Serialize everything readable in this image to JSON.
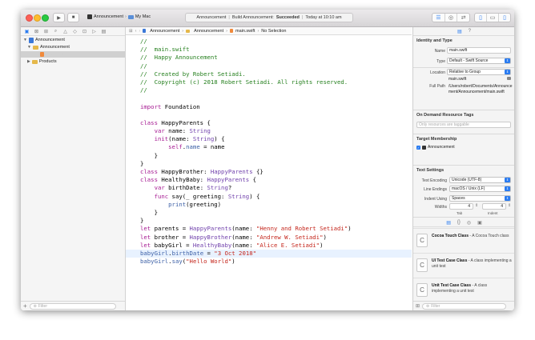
{
  "toolbar": {
    "run_icon": "play-icon",
    "stop_icon": "stop-icon",
    "scheme": "Announcement",
    "destination": "My Mac",
    "status_project": "Announcement",
    "status_build": "Build Announcement:",
    "status_result": "Succeeded",
    "status_time": "Today at 10:10 am"
  },
  "navigator": {
    "tabs": [
      "folder-icon",
      "source-control-icon",
      "symbol-icon",
      "find-icon",
      "issue-icon",
      "test-icon",
      "debug-icon",
      "breakpoint-icon",
      "report-icon"
    ],
    "tree": [
      {
        "label": "Announcement",
        "type": "project"
      },
      {
        "label": "Announcement",
        "type": "folder"
      },
      {
        "label": "main.swift",
        "type": "file"
      },
      {
        "label": "Products",
        "type": "folder"
      }
    ],
    "filter_placeholder": "Filter"
  },
  "jump_bar": {
    "items": [
      "Announcement",
      "Announcement",
      "main.swift",
      "No Selection"
    ]
  },
  "code_lines": [
    [
      [
        "//",
        "cmt"
      ]
    ],
    [
      [
        "//  main.swift",
        "cmt"
      ]
    ],
    [
      [
        "//  Happy Announcement",
        "cmt"
      ]
    ],
    [
      [
        "//",
        "cmt"
      ]
    ],
    [
      [
        "//  Created by Robert Setiadi.",
        "cmt"
      ]
    ],
    [
      [
        "//  Copyright (c) 2018 Robert Setiadi. All rights reserved.",
        "cmt"
      ]
    ],
    [
      [
        "//",
        "cmt"
      ]
    ],
    [],
    [
      [
        "import",
        "kw"
      ],
      [
        " Foundation",
        "plain"
      ]
    ],
    [],
    [
      [
        "class",
        "kw"
      ],
      [
        " HappyParents {",
        "plain"
      ]
    ],
    [
      [
        "    ",
        "plain"
      ],
      [
        "var",
        "kw"
      ],
      [
        " name: ",
        "plain"
      ],
      [
        "String",
        "typ"
      ]
    ],
    [
      [
        "    ",
        "plain"
      ],
      [
        "init",
        "kw"
      ],
      [
        "(name: ",
        "plain"
      ],
      [
        "String",
        "typ"
      ],
      [
        ") {",
        "plain"
      ]
    ],
    [
      [
        "        ",
        "plain"
      ],
      [
        "self",
        "kw"
      ],
      [
        ".",
        "plain"
      ],
      [
        "name",
        "fn"
      ],
      [
        " = name",
        "plain"
      ]
    ],
    [
      [
        "    }",
        "plain"
      ]
    ],
    [
      [
        "}",
        "plain"
      ]
    ],
    [
      [
        "class",
        "kw"
      ],
      [
        " HappyBrother: ",
        "plain"
      ],
      [
        "HappyParents",
        "typ"
      ],
      [
        " {}",
        "plain"
      ]
    ],
    [
      [
        "class",
        "kw"
      ],
      [
        " HealthyBaby: ",
        "plain"
      ],
      [
        "HappyParents",
        "typ"
      ],
      [
        " {",
        "plain"
      ]
    ],
    [
      [
        "    ",
        "plain"
      ],
      [
        "var",
        "kw"
      ],
      [
        " birthDate: ",
        "plain"
      ],
      [
        "String",
        "typ"
      ],
      [
        "?",
        "plain"
      ]
    ],
    [
      [
        "    ",
        "plain"
      ],
      [
        "func",
        "kw"
      ],
      [
        " say(_ greeting: ",
        "plain"
      ],
      [
        "String",
        "typ"
      ],
      [
        ") {",
        "plain"
      ]
    ],
    [
      [
        "        ",
        "plain"
      ],
      [
        "print",
        "fn"
      ],
      [
        "(greeting)",
        "plain"
      ]
    ],
    [
      [
        "    }",
        "plain"
      ]
    ],
    [
      [
        "}",
        "plain"
      ]
    ],
    [
      [
        "let",
        "kw"
      ],
      [
        " parents = ",
        "plain"
      ],
      [
        "HappyParents",
        "typ"
      ],
      [
        "(name: ",
        "plain"
      ],
      [
        "\"Henny and Robert Setiadi\"",
        "str"
      ],
      [
        ")",
        "plain"
      ]
    ],
    [
      [
        "let",
        "kw"
      ],
      [
        " brother = ",
        "plain"
      ],
      [
        "HappyBrother",
        "typ"
      ],
      [
        "(name: ",
        "plain"
      ],
      [
        "\"Andrew W. Setiadi\"",
        "str"
      ],
      [
        ")",
        "plain"
      ]
    ],
    [
      [
        "let",
        "kw"
      ],
      [
        " babyGirl = ",
        "plain"
      ],
      [
        "HealthyBaby",
        "typ"
      ],
      [
        "(name: ",
        "plain"
      ],
      [
        "\"Alice E. Setiadi\"",
        "str"
      ],
      [
        ")",
        "plain"
      ]
    ],
    [
      [
        "babyGirl",
        "fn"
      ],
      [
        ".",
        "plain"
      ],
      [
        "birthDate",
        "fn"
      ],
      [
        " = ",
        "plain"
      ],
      [
        "\"3 Oct 2018\"",
        "str"
      ]
    ],
    [
      [
        "babyGirl",
        "fn"
      ],
      [
        ".",
        "plain"
      ],
      [
        "say",
        "fn"
      ],
      [
        "(",
        "plain"
      ],
      [
        "\"Hello World\"",
        "str"
      ],
      [
        ")",
        "plain"
      ]
    ]
  ],
  "inspector": {
    "identity_title": "Identity and Type",
    "name_label": "Name",
    "name_value": "main.swift",
    "type_label": "Type",
    "type_value": "Default - Swift Source",
    "location_label": "Location",
    "location_value": "Relative to Group",
    "location_file": "main.swift",
    "fullpath_label": "Full Path",
    "fullpath_value": "/Users/robert/Documents/Announcement/Announcement/main.swift",
    "odr_title": "On Demand Resource Tags",
    "odr_placeholder": "Only resources are taggable",
    "target_title": "Target Membership",
    "target_name": "Announcement",
    "text_title": "Text Settings",
    "encoding_label": "Text Encoding",
    "encoding_value": "Unicode (UTF-8)",
    "endings_label": "Line Endings",
    "endings_value": "macOS / Unix (LF)",
    "indent_label": "Indent Using",
    "indent_value": "Spaces",
    "widths_label": "Widths",
    "tab_width": "4",
    "indent_width": "4",
    "tab_label": "Tab",
    "indent_label2": "Indent",
    "library": [
      {
        "title": "Cocoa Touch Class",
        "desc": " - A Cocoa Touch class",
        "icon": "C"
      },
      {
        "title": "UI Test Case Class",
        "desc": " - A class implementing a unit test",
        "icon": "C"
      },
      {
        "title": "Unit Test Case Class",
        "desc": " - A class implementing a unit test",
        "icon": "C"
      }
    ],
    "filter_placeholder": "Filter"
  }
}
